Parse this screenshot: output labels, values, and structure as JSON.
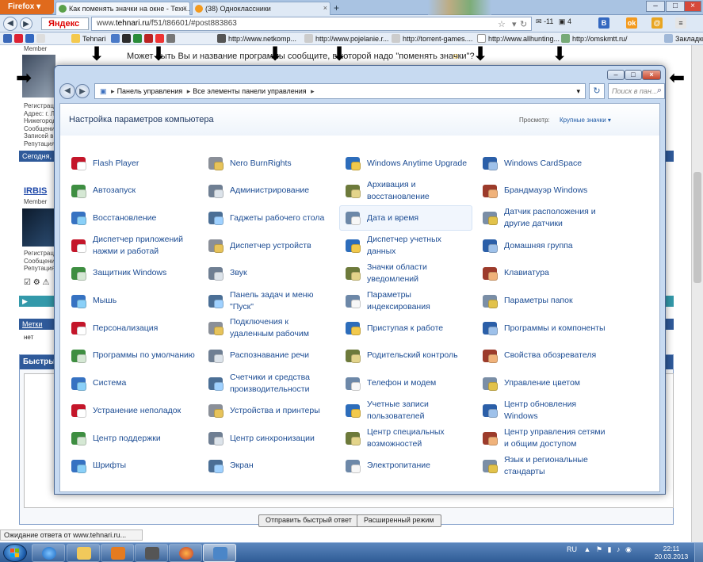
{
  "browser": {
    "menu_label": "Firefox",
    "tabs": [
      {
        "label": "Как поменять значки на окне - Техн...",
        "active": true
      },
      {
        "label": "(38) Одноклассники",
        "active": false
      }
    ],
    "search_engine": "Яндекс",
    "url_prefix": "www.",
    "url_host": "tehnari.ru",
    "url_rest": "/f51/t86601/#post883863",
    "toolbar_counts": {
      "mail": "-11",
      "notes": "4"
    },
    "bookmarks": [
      {
        "label": "Tehnari"
      },
      {
        "label": "http://www.netkomp..."
      },
      {
        "label": "http://www.pojelanie.r..."
      },
      {
        "label": "http://torrent-games...."
      },
      {
        "label": "http://www.allhunting..."
      },
      {
        "label": "http://omskmtt.ru/"
      },
      {
        "label": "Закладки"
      }
    ],
    "status_text": "Ожидание ответа от www.tehnari.ru..."
  },
  "forum": {
    "member_label": "Member",
    "question_text": "Может быть Вы и название программы сообщите, в которой надо \"поменять значки\"?",
    "user_info": [
      "Регистрация:",
      "Адрес: г. Л",
      "Нижегород",
      "Сообщени",
      "Записей в",
      "Репутация"
    ],
    "today_label": "Сегодня, 2...",
    "second_user": "IRBIS",
    "second_user_info": [
      "Регистрация:",
      "Сообщени",
      "Репутация"
    ],
    "tags_header": "Метки",
    "tags_value": "нет",
    "quick_header": "Быстры",
    "quick_reply_button": "Отправить быстрый ответ",
    "advanced_button": "Расширенный режим"
  },
  "control_panel": {
    "breadcrumb": [
      "Панель управления",
      "Все элементы панели управления"
    ],
    "search_placeholder": "Поиск в пан...",
    "header_title": "Настройка параметров компьютера",
    "view_label": "Просмотр:",
    "view_value": "Крупные значки",
    "items": [
      {
        "label": "Flash Player",
        "icon": "flash-player-icon"
      },
      {
        "label": "Nero BurnRights",
        "icon": "nero-icon"
      },
      {
        "label": "Windows Anytime Upgrade",
        "icon": "windows-upgrade-icon"
      },
      {
        "label": "Windows CardSpace",
        "icon": "cardspace-icon"
      },
      {
        "label": "Автозапуск",
        "icon": "autoplay-icon"
      },
      {
        "label": "Администрирование",
        "icon": "admin-tools-icon"
      },
      {
        "label": "Архивация и восстановление",
        "icon": "backup-icon"
      },
      {
        "label": "Брандмауэр Windows",
        "icon": "firewall-icon"
      },
      {
        "label": "Восстановление",
        "icon": "recovery-icon"
      },
      {
        "label": "Гаджеты рабочего стола",
        "icon": "gadgets-icon"
      },
      {
        "label": "Дата и время",
        "icon": "date-time-icon"
      },
      {
        "label": "Датчик расположения и другие датчики",
        "icon": "location-sensor-icon"
      },
      {
        "label": "Диспетчер приложений нажми и работай",
        "icon": "app-manager-icon"
      },
      {
        "label": "Диспетчер устройств",
        "icon": "device-manager-icon"
      },
      {
        "label": "Диспетчер учетных данных",
        "icon": "credential-manager-icon"
      },
      {
        "label": "Домашняя группа",
        "icon": "homegroup-icon"
      },
      {
        "label": "Защитник Windows",
        "icon": "defender-icon"
      },
      {
        "label": "Звук",
        "icon": "sound-icon"
      },
      {
        "label": "Значки области уведомлений",
        "icon": "notification-icons-icon"
      },
      {
        "label": "Клавиатура",
        "icon": "keyboard-icon"
      },
      {
        "label": "Мышь",
        "icon": "mouse-icon"
      },
      {
        "label": "Панель задач и меню \"Пуск\"",
        "icon": "taskbar-start-icon"
      },
      {
        "label": "Параметры индексирования",
        "icon": "indexing-icon"
      },
      {
        "label": "Параметры папок",
        "icon": "folder-options-icon"
      },
      {
        "label": "Персонализация",
        "icon": "personalization-icon"
      },
      {
        "label": "Подключения к удаленным рабочим",
        "icon": "remote-desktop-icon"
      },
      {
        "label": "Приступая к работе",
        "icon": "getting-started-icon"
      },
      {
        "label": "Программы и компоненты",
        "icon": "programs-features-icon"
      },
      {
        "label": "Программы по умолчанию",
        "icon": "default-programs-icon"
      },
      {
        "label": "Распознавание речи",
        "icon": "speech-recognition-icon"
      },
      {
        "label": "Родительский контроль",
        "icon": "parental-controls-icon"
      },
      {
        "label": "Свойства обозревателя",
        "icon": "internet-options-icon"
      },
      {
        "label": "Система",
        "icon": "system-icon"
      },
      {
        "label": "Счетчики и средства производительности",
        "icon": "performance-icon"
      },
      {
        "label": "Телефон и модем",
        "icon": "phone-modem-icon"
      },
      {
        "label": "Управление цветом",
        "icon": "color-management-icon"
      },
      {
        "label": "Устранение неполадок",
        "icon": "troubleshooting-icon"
      },
      {
        "label": "Устройства и принтеры",
        "icon": "devices-printers-icon"
      },
      {
        "label": "Учетные записи пользователей",
        "icon": "user-accounts-icon"
      },
      {
        "label": "Центр обновления Windows",
        "icon": "windows-update-icon"
      },
      {
        "label": "Центр поддержки",
        "icon": "action-center-icon"
      },
      {
        "label": "Центр синхронизации",
        "icon": "sync-center-icon"
      },
      {
        "label": "Центр специальных возможностей",
        "icon": "ease-of-access-icon"
      },
      {
        "label": "Центр управления сетями и общим доступом",
        "icon": "network-center-icon"
      },
      {
        "label": "Шрифты",
        "icon": "fonts-icon"
      },
      {
        "label": "Экран",
        "icon": "display-icon"
      },
      {
        "label": "Электропитание",
        "icon": "power-options-icon"
      },
      {
        "label": "Язык и региональные стандарты",
        "icon": "region-language-icon"
      }
    ],
    "highlighted_item": "Дата и время"
  },
  "taskbar": {
    "language": "RU",
    "time": "22:11",
    "date": "20.03.2013"
  }
}
